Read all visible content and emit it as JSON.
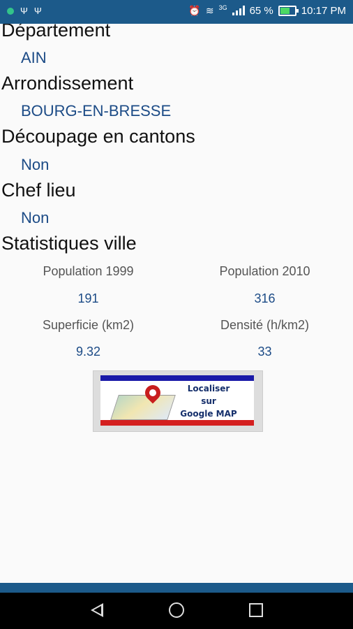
{
  "status_bar": {
    "battery_percent_text": "65 %",
    "time": "10:17 PM",
    "network_label": "3G",
    "battery_level": 0.65,
    "icons": [
      "notification-dot-icon",
      "usb-icon",
      "usb-icon",
      "alarm-icon",
      "wifi-icon",
      "signal-icon",
      "battery-icon"
    ]
  },
  "fields": [
    {
      "label": "Département",
      "value": "AIN"
    },
    {
      "label": "Arrondissement",
      "value": "BOURG-EN-BRESSE"
    },
    {
      "label": "Découpage en cantons",
      "value": "Non"
    },
    {
      "label": "Chef lieu",
      "value": "Non"
    }
  ],
  "stats": {
    "title": "Statistiques ville",
    "items": [
      {
        "label": "Population 1999",
        "value": "191"
      },
      {
        "label": "Population 2010",
        "value": "316"
      },
      {
        "label": "Superficie (km2)",
        "value": "9.32"
      },
      {
        "label": "Densité (h/km2)",
        "value": "33"
      }
    ]
  },
  "map_button": {
    "line1": "Localiser",
    "line2": "sur",
    "line3": "Google MAP"
  },
  "colors": {
    "accent": "#1c5a8a",
    "value_text": "#1c4b86",
    "flag_blue": "#1a1aa8",
    "flag_red": "#d41f1f"
  },
  "navigation": {
    "icons": [
      "back-icon",
      "home-icon",
      "recent-apps-icon"
    ]
  }
}
